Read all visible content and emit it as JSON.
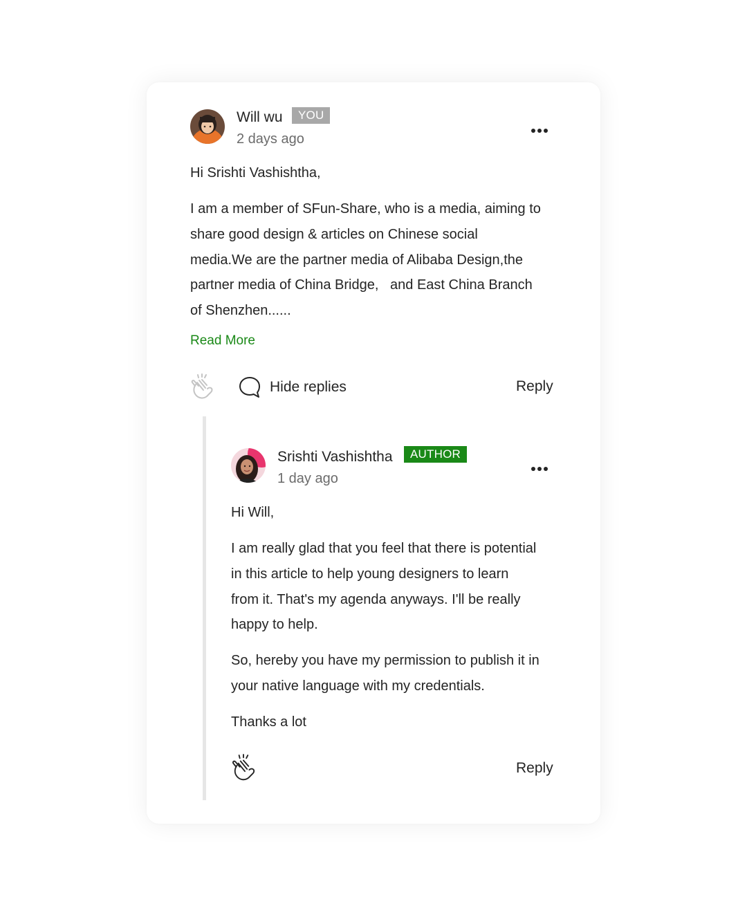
{
  "comment": {
    "author": "Will wu",
    "badge": "YOU",
    "time": "2 days ago",
    "paragraphs": [
      [
        "Hi Srishti Vashishtha,"
      ],
      [
        "I am a member of SFun-Share, who is a media, aiming to",
        "share good design & articles on Chinese social",
        "media.We are the partner media of Alibaba Design,the",
        "partner media of China Bridge,   and East China Branch",
        "of Shenzhen......"
      ]
    ],
    "read_more": "Read More",
    "hide_replies": "Hide replies",
    "reply_label": "Reply",
    "icons": [
      "avatar",
      "more-icon",
      "clap-icon",
      "comment-bubble-icon"
    ]
  },
  "reply": {
    "author": "Srishti Vashishtha",
    "badge": "AUTHOR",
    "time": "1 day ago",
    "paragraphs": [
      [
        "Hi Will,"
      ],
      [
        "I am really glad that you feel that there is potential",
        "in this article to help young designers to learn",
        "from it. That's my agenda anyways. I'll be really",
        "happy to help."
      ],
      [
        "So, hereby you have my permission to publish it in",
        "your native language with my credentials."
      ],
      [
        "Thanks a lot"
      ]
    ],
    "reply_label": "Reply",
    "icons": [
      "avatar",
      "more-icon",
      "clap-icon"
    ]
  },
  "colors": {
    "accent_green": "#1a8917",
    "you_badge": "#a8a8a8",
    "text": "#242424",
    "muted": "#6b6b6b",
    "thread_line": "#e6e6e6"
  }
}
